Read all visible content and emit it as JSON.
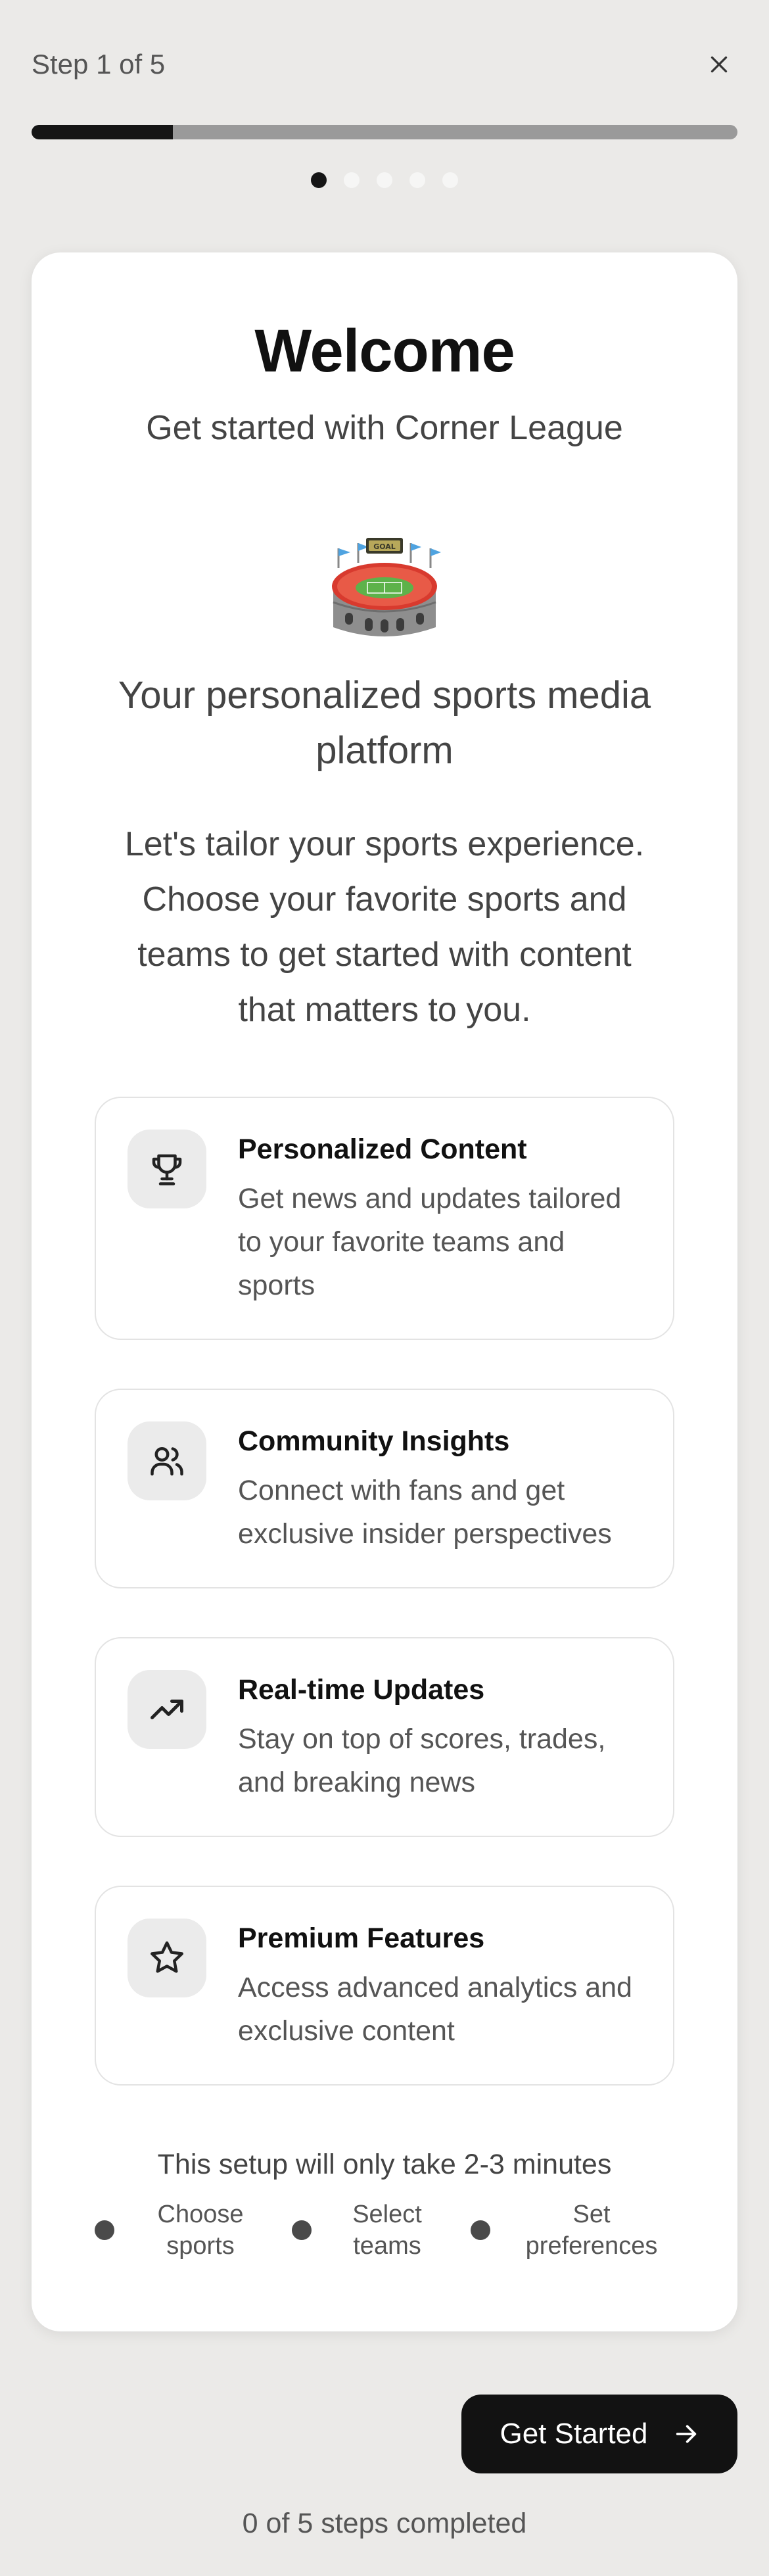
{
  "header": {
    "step_label": "Step 1 of 5",
    "close_icon": "close-icon"
  },
  "progress": {
    "fraction": 0.2,
    "fill_color": "#151515",
    "track_color": "#9A9A9A"
  },
  "pager": {
    "total": 5,
    "active_index": 0
  },
  "welcome": {
    "title": "Welcome",
    "subtitle": "Get started with Corner League",
    "illustration": "stadium-emoji",
    "tagline_line1": "Your personalized sports media",
    "tagline_line2": "platform",
    "desc_line1": "Let's tailor your sports experience.",
    "desc_line2": "Choose your favorite sports and",
    "desc_line3": "teams to get started with content",
    "desc_line4": "that matters to you."
  },
  "features": [
    {
      "icon": "trophy-icon",
      "title": "Personalized Content",
      "desc_line1": "Get news and updates tailored",
      "desc_line2": "to your favorite teams and",
      "desc_line3": "sports"
    },
    {
      "icon": "users-icon",
      "title": "Community Insights",
      "desc_line1": "Connect with fans and get",
      "desc_line2": "exclusive insider perspectives"
    },
    {
      "icon": "trending-up-icon",
      "title": "Real-time Updates",
      "desc_line1": "Stay on top of scores, trades,",
      "desc_line2": "and breaking news"
    },
    {
      "icon": "star-icon",
      "title": "Premium Features",
      "desc_line1": "Access advanced analytics and",
      "desc_line2": "exclusive content"
    }
  ],
  "setup": {
    "note": "This setup will only take 2-3 minutes",
    "steps": [
      {
        "line1": "Choose",
        "line2": "sports"
      },
      {
        "line1": "Select",
        "line2": "teams"
      },
      {
        "line1": "Set",
        "line2": "preferences"
      }
    ]
  },
  "cta": {
    "label": "Get Started",
    "icon": "arrow-right-icon"
  },
  "footer": {
    "status": "0 of 5 steps completed"
  }
}
